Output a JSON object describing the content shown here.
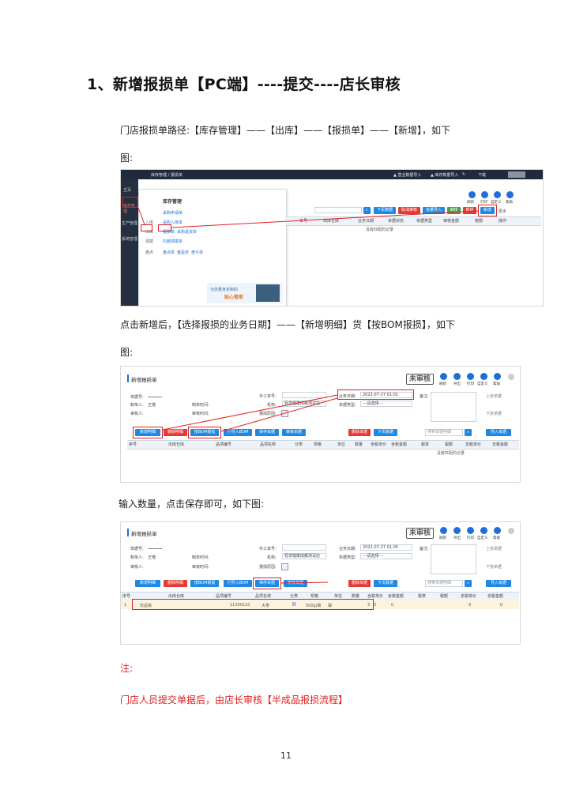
{
  "heading": "1、新增报损单【PC端】----提交----店长审核",
  "p1": "门店报损单路径:【库存管理】——【出库】——【报损单】——【新增】，如下",
  "p1b": "图:",
  "p2": "点击新增后，【选择报损的业务日期】——【新增明细】货【按BOM报损】，如下",
  "p2b": "图:",
  "p3": "输入数量，点击保存即可，如下图:",
  "note_label": "注:",
  "note_text": "门店人员提交单据后，由店长审核【半成品报损流程】",
  "page_number": "11",
  "shot1": {
    "breadcrumb": "库存管理 / 报损单",
    "topbar_right": [
      "▲ 营业数据导入",
      "▲ 库存数据导入",
      "↻",
      "下载"
    ],
    "sidebar": [
      "主页",
      "库存管理",
      "生产管理",
      "系统管理"
    ],
    "menu_title": "库存管理",
    "menu_rows": [
      {
        "head": "",
        "items": [
          "采购申请单"
        ]
      },
      {
        "head": "入库",
        "items": [
          "采购入库单"
        ]
      },
      {
        "head": "出库",
        "items": [
          "报损单",
          "采购退货单"
        ]
      },
      {
        "head": "调拨",
        "items": [
          "内部调拨单"
        ]
      },
      {
        "head": "盘点",
        "items": [
          "盘点单",
          "盘盈单",
          "盘亏单"
        ]
      }
    ],
    "promo_line1": "为您量身定制的",
    "promo_line2": "贴心管家",
    "toolbar_icons": [
      "刷新",
      "打印",
      "自定义",
      "帮助"
    ],
    "buttons": [
      "下页数据",
      "取消审核",
      "批量导入",
      "审核",
      "新增",
      "新增"
    ],
    "more": "更多",
    "columns": [
      "单号",
      "出库仓库",
      "业务日期",
      "单据状态",
      "单据类型",
      "审核金额",
      "税额",
      "操作"
    ],
    "empty": "没有匹配的记录"
  },
  "shot2": {
    "title": "新增报损单",
    "status": "未审核",
    "toolbar_icons": [
      "刷新",
      "导出",
      "打印",
      "自定义",
      "帮助"
    ],
    "labels": {
      "bill_no": "单据号:",
      "maker": "制单人:",
      "maker_value": "王楷",
      "make_time": "制单时间:",
      "auditor": "审核人:",
      "audit_time": "审核时间:",
      "manual_no": "手工单号:",
      "org": "机构:",
      "org_value": "轻享健康成都测试店",
      "cause": "报损原因:",
      "biz_date": "业务日期:",
      "biz_date_value": "2022-07-27 01:01",
      "bill_type": "单据类型:",
      "bill_type_value": "---请选择---",
      "remark": "备注:",
      "prev": "上张单据",
      "next": "下张单据"
    },
    "buttons": [
      "新增明细",
      "删除明细",
      "按BOM报损",
      "行导入BOM",
      "保存单据",
      "审核单据"
    ],
    "right_buttons": [
      "删除单据",
      "下页数据"
    ],
    "search_placeholder": "搜索单据明细",
    "import_btn": "导入单据",
    "columns": [
      "序号",
      "出库仓库",
      "品项编号",
      "品项名称",
      "分类",
      "规格",
      "单位",
      "数量",
      "含税单价",
      "含税金额",
      "税率",
      "税额",
      "去税单价",
      "去税金额"
    ],
    "empty": "没有匹配的记录"
  },
  "shot3": {
    "title": "新增报损单",
    "status": "未审核",
    "toolbar_icons": [
      "刷新",
      "导出",
      "打印",
      "自定义",
      "帮助"
    ],
    "biz_date_value": "2022-07-27 01:05",
    "buttons": [
      "新增明细",
      "删除明细",
      "按BOM报损",
      "行导入BOM",
      "保存单据",
      "审核单据"
    ],
    "right_buttons": [
      "删除单据",
      "下页数据"
    ],
    "search_placeholder": "搜索单据明细",
    "import_btn": "导入单据",
    "row": {
      "idx": "1",
      "warehouse": "饮品库",
      "code": "11100110",
      "name": "大枣",
      "spec": "500g/袋",
      "unit": "袋",
      "qty": "3",
      "price": "0",
      "amount": "0",
      "tax_amount": "0",
      "notax_price": "0"
    }
  }
}
